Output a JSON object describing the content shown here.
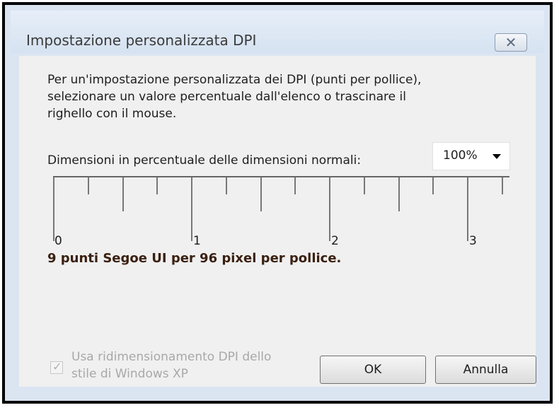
{
  "dialog": {
    "title": "Impostazione personalizzata DPI",
    "close_icon": "close-icon"
  },
  "description": [
    "Per un'impostazione personalizzata dei DPI (punti per pollice),",
    "selezionare un valore percentuale dall'elenco o trascinare il",
    "righello con il mouse."
  ],
  "scale": {
    "label": "Dimensioni in percentuale delle dimensioni normali:",
    "selected_value": "100%"
  },
  "ruler": {
    "labels": [
      "0",
      "1",
      "2",
      "3"
    ]
  },
  "font_info": "9 punti Segoe UI per 96 pixel per pollice.",
  "checkbox": {
    "label_lines": [
      "Usa ridimensionamento DPI dello",
      "stile di Windows XP"
    ],
    "checked": true,
    "disabled": true
  },
  "buttons": {
    "ok": "OK",
    "cancel": "Annulla"
  }
}
